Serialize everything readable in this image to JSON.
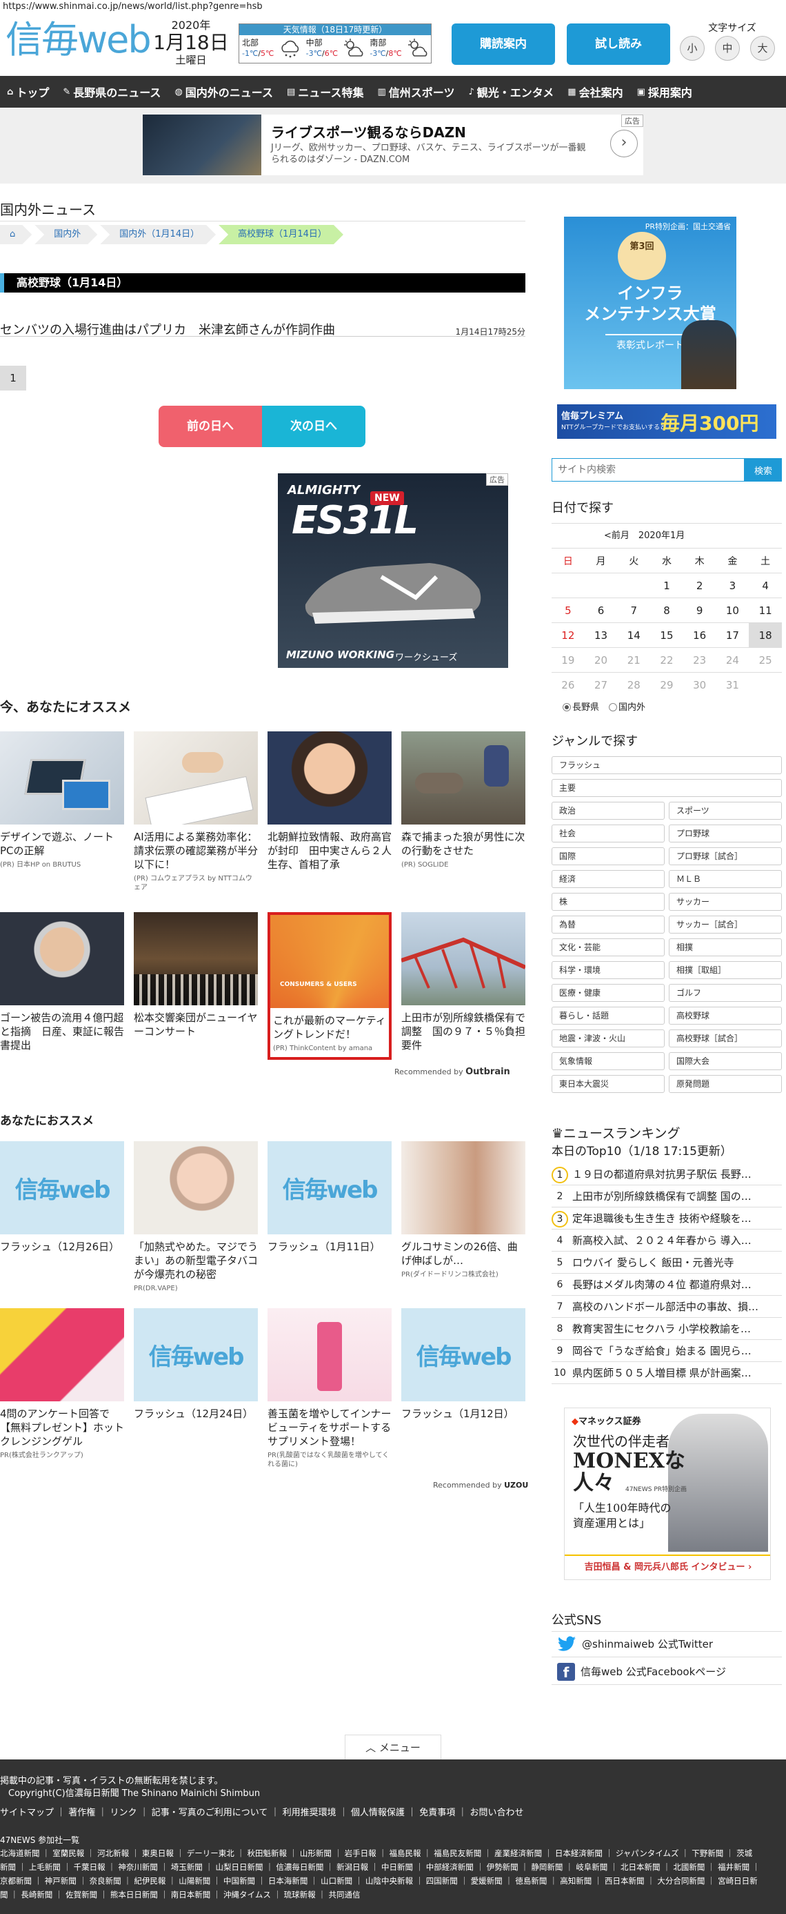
{
  "url": "https://www.shinmai.co.jp/news/world/list.php?genre=hsb",
  "header": {
    "logo": "信毎web",
    "year": "2020年",
    "monthday": "1月18日",
    "weekday": "土曜日",
    "weather_title": "天気情報（18日17時更新）",
    "weather": [
      {
        "name": "北部",
        "low": "-1℃",
        "high": "5℃",
        "icon": "snow-cloud-icon"
      },
      {
        "name": "中部",
        "low": "-3℃",
        "high": "6℃",
        "icon": "sun-cloud-icon"
      },
      {
        "name": "南部",
        "low": "-3℃",
        "high": "8℃",
        "icon": "sun-cloud-icon"
      }
    ],
    "subscribe_label": "購読案内",
    "trial_label": "試し読み",
    "fontsize_label": "文字サイズ",
    "fontsizes": [
      "小",
      "中",
      "大"
    ]
  },
  "nav": [
    {
      "label": "トップ",
      "icon": "home-icon"
    },
    {
      "label": "長野県のニュース",
      "icon": "pen-icon"
    },
    {
      "label": "国内外のニュース",
      "icon": "globe-icon"
    },
    {
      "label": "ニュース特集",
      "icon": "doc-icon"
    },
    {
      "label": "信州スポーツ",
      "icon": "bars-icon"
    },
    {
      "label": "観光・エンタメ",
      "icon": "guitar-icon"
    },
    {
      "label": "会社案内",
      "icon": "building-icon"
    },
    {
      "label": "採用案内",
      "icon": "id-icon"
    }
  ],
  "top_ad": {
    "tag": "広告",
    "title": "ライブスポーツ観るならDAZN",
    "text": "Jリーグ、欧州サッカー、プロ野球、バスケ、テニス、ライブスポーツが一番観られるのはダゾーン - DAZN.COM",
    "arrow": "›"
  },
  "main": {
    "section_title": "国内外ニュース",
    "breadcrumbs": [
      "⌂",
      "国内外",
      "国内外（1月14日）",
      "高校野球（1月14日）"
    ],
    "genre_bar": "高校野球（1月14日）",
    "article": {
      "title": "センバツの入場行進曲はパプリカ　米津玄師さんが作詞作曲",
      "time": "1月14日17時25分"
    },
    "page": "1",
    "prev_day": "前の日へ",
    "next_day": "次の日へ",
    "shoe_ad": {
      "tag": "広告",
      "brand": "ALMIGHTY",
      "model": "ES31L",
      "new": "NEW",
      "maker": "MIZUNO WORKING",
      "cat": "ワークシューズ"
    },
    "recommend_title": "今、あなたにオススメ",
    "recommend": [
      {
        "title": "デザインで遊ぶ、ノートPCの正解",
        "sponsor": "(PR) 日本HP on BRUTUS"
      },
      {
        "title": "AI活用による業務効率化：請求伝票の確認業務が半分以下に！",
        "sponsor": "(PR) コムウェアプラス by NTTコムウェア"
      },
      {
        "title": "北朝鮮拉致情報、政府高官が封印　田中実さんら２人生存、首相了承",
        "sponsor": ""
      },
      {
        "title": "森で捕まった狼が男性に次の行動をさせた",
        "sponsor": "(PR) SOGLIDE"
      },
      {
        "title": "ゴーン被告の流用４億円超と指摘　日産、東証に報告書提出",
        "sponsor": ""
      },
      {
        "title": "松本交響楽団がニューイヤーコンサート",
        "sponsor": ""
      },
      {
        "title": "これが最新のマーケティングトレンドだ！",
        "sponsor": "(PR) ThinkContent by amana"
      },
      {
        "title": "上田市が別所線鉄橋保有で調整　国の９７・５％負担要件",
        "sponsor": ""
      }
    ],
    "outbrain": {
      "prefix": "Recommended by",
      "brand": "Outbrain"
    },
    "recommend2_title": "あなたにおススメ",
    "recommend2": [
      {
        "title": "フラッシュ（12月26日）",
        "sponsor": "",
        "logo": "信毎web"
      },
      {
        "title": "「加熱式やめた。マジでうまい」あの新型電子タバコが今爆売れの秘密",
        "sponsor": "PR(DR.VAPE)",
        "logo": ""
      },
      {
        "title": "フラッシュ（1月11日）",
        "sponsor": "",
        "logo": "信毎web"
      },
      {
        "title": "グルコサミンの26倍、曲げ伸ばしが…",
        "sponsor": "PR(ダイドードリンコ株式会社)",
        "logo": ""
      },
      {
        "title": "4問のアンケート回答で【無料プレゼント】ホットクレンジングゲル",
        "sponsor": "PR(株式会社ランクアップ)",
        "logo": ""
      },
      {
        "title": "フラッシュ（12月24日）",
        "sponsor": "",
        "logo": "信毎web"
      },
      {
        "title": "善玉菌を増やしてインナービューティをサポートするサプリメント登場！",
        "sponsor": "PR(乳酸菌ではなく乳酸菌を増やしてくれる菌に)",
        "logo": ""
      },
      {
        "title": "フラッシュ（1月12日）",
        "sponsor": "",
        "logo": "信毎web"
      }
    ],
    "uzou": {
      "prefix": "Recommended by",
      "brand": "UZOU"
    },
    "menu_label": "メニュー"
  },
  "side": {
    "banner1": {
      "pr": "PR特別企画：国土交通省",
      "num": "第3回",
      "title1": "インフラ",
      "title2": "メンテナンス大賞",
      "sub": "表彰式レポート"
    },
    "banner2": {
      "a": "信毎プレミアム",
      "b": "NTTグループカードでお支払いすると",
      "c": "毎月300円"
    },
    "search_placeholder": "サイト内検索",
    "search_button": "検索",
    "calendar_title": "日付で探す",
    "calendar_month": "<前月　2020年1月",
    "weekdays": [
      "日",
      "月",
      "火",
      "水",
      "木",
      "金",
      "土"
    ],
    "weeks": [
      [
        "",
        "",
        "",
        "1",
        "2",
        "3",
        "4"
      ],
      [
        "5",
        "6",
        "7",
        "8",
        "9",
        "10",
        "11"
      ],
      [
        "12",
        "13",
        "14",
        "15",
        "16",
        "17",
        "18"
      ],
      [
        "19",
        "20",
        "21",
        "22",
        "23",
        "24",
        "25"
      ],
      [
        "26",
        "27",
        "28",
        "29",
        "30",
        "31",
        ""
      ]
    ],
    "cal_radio": [
      "長野県",
      "国内外"
    ],
    "genre_title": "ジャンルで探す",
    "genres_full": [
      "フラッシュ",
      "主要"
    ],
    "genres_left": [
      "政治",
      "社会",
      "国際",
      "経済",
      "株",
      "為替",
      "文化・芸能",
      "科学・環境",
      "医療・健康",
      "暮らし・話題",
      "地震・津波・火山",
      "気象情報",
      "東日本大震災"
    ],
    "genres_right": [
      "スポーツ",
      "プロ野球",
      "プロ野球［試合］",
      "ＭＬＢ",
      "サッカー",
      "サッカー［試合］",
      "相撲",
      "相撲［取組］",
      "ゴルフ",
      "高校野球",
      "高校野球［試合］",
      "国際大会",
      "原発問題"
    ],
    "ranking_title": "ニュースランキング",
    "ranking_sub": "本日のTop10（1/18 17:15更新）",
    "ranking": [
      "１９日の都道府県対抗男子駅伝 長野…",
      "上田市が別所線鉄橋保有で調整 国の…",
      "定年退職後も生き生き 技術や経験を…",
      "新高校入試、２０２４年春から 導入…",
      "ロウバイ 愛らしく 飯田・元善光寺",
      "長野はメダル肉薄の４位 都道府県対…",
      "高校のハンドボール部活中の事故、損…",
      "教育実習生にセクハラ 小学校教諭を…",
      "岡谷で「うなぎ給食」始まる 園児ら…",
      "県内医師５０５人増目標 県が計画案…"
    ],
    "monex": {
      "logo": "マネックス証券",
      "t1": "次世代の伴走者",
      "t2": "MONEXな",
      "t3": "人々",
      "pr": "47NEWS PR特別企画",
      "t4": "「人生100年時代の",
      "t5": "資産運用とは」",
      "bar": "吉田恒昌 & 岡元兵八郎氏 インタビュー ›"
    },
    "sns_title": "公式SNS",
    "twitter": "@shinmaiweb 公式Twitter",
    "facebook": "信毎web 公式Facebookページ"
  },
  "footer": {
    "notice": "掲載中の記事・写真・イラストの無断転用を禁じます。",
    "copyright": "Copyright(C)信濃毎日新聞 The Shinano Mainichi Shimbun",
    "links": "サイトマップ ｜ 著作権 ｜ リンク ｜ 記事・写真のご利用について ｜ 利用推奨環境 ｜ 個人情報保護 ｜ 免責事項 ｜ お問い合わせ",
    "n47_title": "47NEWS 参加社一覧",
    "n47_line1": "北海道新聞 ｜ 室蘭民報 ｜ 河北新報 ｜ 東奥日報 ｜ デーリー東北 ｜ 秋田魁新報 ｜ 山形新聞 ｜ 岩手日報 ｜ 福島民報 ｜ 福島民友新聞 ｜ 産業経済新聞 ｜ 日本経済新聞 ｜ ジャパンタイムズ ｜ 下野新聞 ｜ 茨城",
    "n47_line2": "新聞 ｜ 上毛新聞 ｜ 千葉日報 ｜ 神奈川新聞 ｜ 埼玉新聞 ｜ 山梨日日新聞 ｜ 信濃毎日新聞 ｜ 新潟日報 ｜ 中日新聞 ｜ 中部経済新聞 ｜ 伊勢新聞 ｜ 静岡新聞 ｜ 岐阜新聞 ｜ 北日本新聞 ｜ 北國新聞 ｜ 福井新聞 ｜",
    "n47_line3": "京都新聞 ｜ 神戸新聞 ｜ 奈良新聞 ｜ 紀伊民報 ｜ 山陽新聞 ｜ 中国新聞 ｜ 日本海新聞 ｜ 山口新聞 ｜ 山陰中央新報 ｜ 四国新聞 ｜ 愛媛新聞 ｜ 徳島新聞 ｜ 高知新聞 ｜ 西日本新聞 ｜ 大分合同新聞 ｜ 宮崎日日新",
    "n47_line4": "聞 ｜ 長崎新聞 ｜ 佐賀新聞 ｜ 熊本日日新聞 ｜ 南日本新聞 ｜ 沖縄タイムス ｜ 琉球新報 ｜ 共同通信"
  }
}
